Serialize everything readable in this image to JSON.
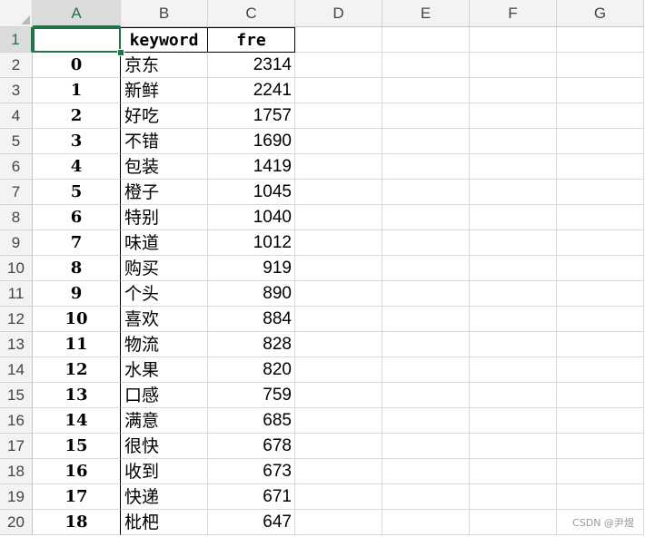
{
  "columns": [
    "A",
    "B",
    "C",
    "D",
    "E",
    "F",
    "G"
  ],
  "active_column": "A",
  "active_row": "1",
  "header_row": {
    "a": "",
    "b": "keyword",
    "c": "fre"
  },
  "rows": [
    {
      "row": "2",
      "idx": "0",
      "keyword": "京东",
      "fre": "2314"
    },
    {
      "row": "3",
      "idx": "1",
      "keyword": "新鲜",
      "fre": "2241"
    },
    {
      "row": "4",
      "idx": "2",
      "keyword": "好吃",
      "fre": "1757"
    },
    {
      "row": "5",
      "idx": "3",
      "keyword": "不错",
      "fre": "1690"
    },
    {
      "row": "6",
      "idx": "4",
      "keyword": "包装",
      "fre": "1419"
    },
    {
      "row": "7",
      "idx": "5",
      "keyword": "橙子",
      "fre": "1045"
    },
    {
      "row": "8",
      "idx": "6",
      "keyword": "特别",
      "fre": "1040"
    },
    {
      "row": "9",
      "idx": "7",
      "keyword": "味道",
      "fre": "1012"
    },
    {
      "row": "10",
      "idx": "8",
      "keyword": "购买",
      "fre": "919"
    },
    {
      "row": "11",
      "idx": "9",
      "keyword": "个头",
      "fre": "890"
    },
    {
      "row": "12",
      "idx": "10",
      "keyword": "喜欢",
      "fre": "884"
    },
    {
      "row": "13",
      "idx": "11",
      "keyword": "物流",
      "fre": "828"
    },
    {
      "row": "14",
      "idx": "12",
      "keyword": "水果",
      "fre": "820"
    },
    {
      "row": "15",
      "idx": "13",
      "keyword": "口感",
      "fre": "759"
    },
    {
      "row": "16",
      "idx": "14",
      "keyword": "满意",
      "fre": "685"
    },
    {
      "row": "17",
      "idx": "15",
      "keyword": "很快",
      "fre": "678"
    },
    {
      "row": "18",
      "idx": "16",
      "keyword": "收到",
      "fre": "673"
    },
    {
      "row": "19",
      "idx": "17",
      "keyword": "快递",
      "fre": "671"
    },
    {
      "row": "20",
      "idx": "18",
      "keyword": "枇杷",
      "fre": "647"
    }
  ],
  "watermark": "CSDN @尹煜",
  "colors": {
    "accent": "#217346",
    "header_bg": "#f3f3f3",
    "gridline": "#d9d9d9"
  }
}
